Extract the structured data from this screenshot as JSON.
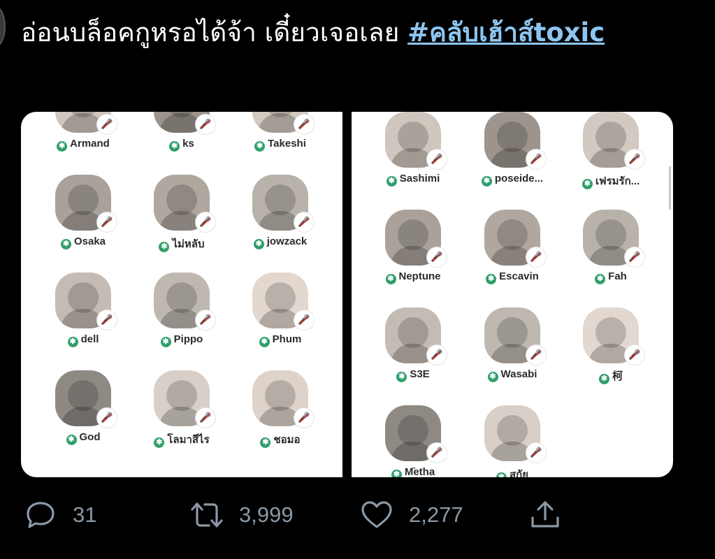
{
  "tweet": {
    "text_part1": "อ่อนบล็อคกูหรอได้จ้า เดี๋ยวเจอเลย ",
    "hashtag": "#คลับเฮ้าส์toxic"
  },
  "left_panel": {
    "rows": [
      [
        "Armand",
        "ks",
        "Takeshi"
      ],
      [
        "Osaka",
        "ไม่หลับ",
        "jowzack"
      ],
      [
        "dell",
        "Pippo",
        "Phum"
      ],
      [
        "God",
        "โลมาสีไร",
        "ชอมอ"
      ]
    ]
  },
  "right_panel": {
    "rows": [
      [
        "Sashimi",
        "poseide...",
        "เฟรมรัก..."
      ],
      [
        "Neptune",
        "Escavin",
        "Fah"
      ],
      [
        "S3E",
        "Wasabi",
        "柯"
      ],
      [
        "Mֹ̈etha",
        "สกัย"
      ]
    ]
  },
  "actions": {
    "reply_count": "31",
    "retweet_count": "3,999",
    "like_count": "2,277"
  },
  "colors": {
    "background": "#000000",
    "hashtag": "#8ec5f0",
    "moderator_badge": "#2f9e6a",
    "action_gray": "#8b98a5"
  }
}
